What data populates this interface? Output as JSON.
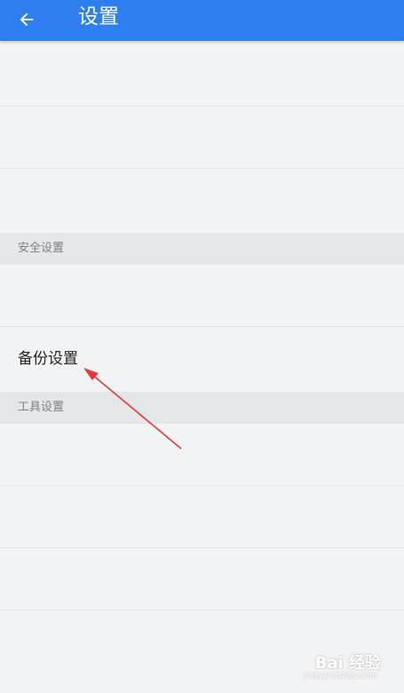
{
  "header": {
    "title": "设置",
    "back_icon": "arrow-left-icon"
  },
  "sections": {
    "security": {
      "label": "安全设置"
    },
    "backup": {
      "label": "备份设置"
    },
    "tools": {
      "label": "工具设置"
    }
  },
  "colors": {
    "appbar": "#2f7ef0",
    "background": "#f2f3f5",
    "arrow": "#e53935"
  },
  "watermark": {
    "text": "Bai 经验",
    "sub": "jingyan.baidu.com"
  }
}
